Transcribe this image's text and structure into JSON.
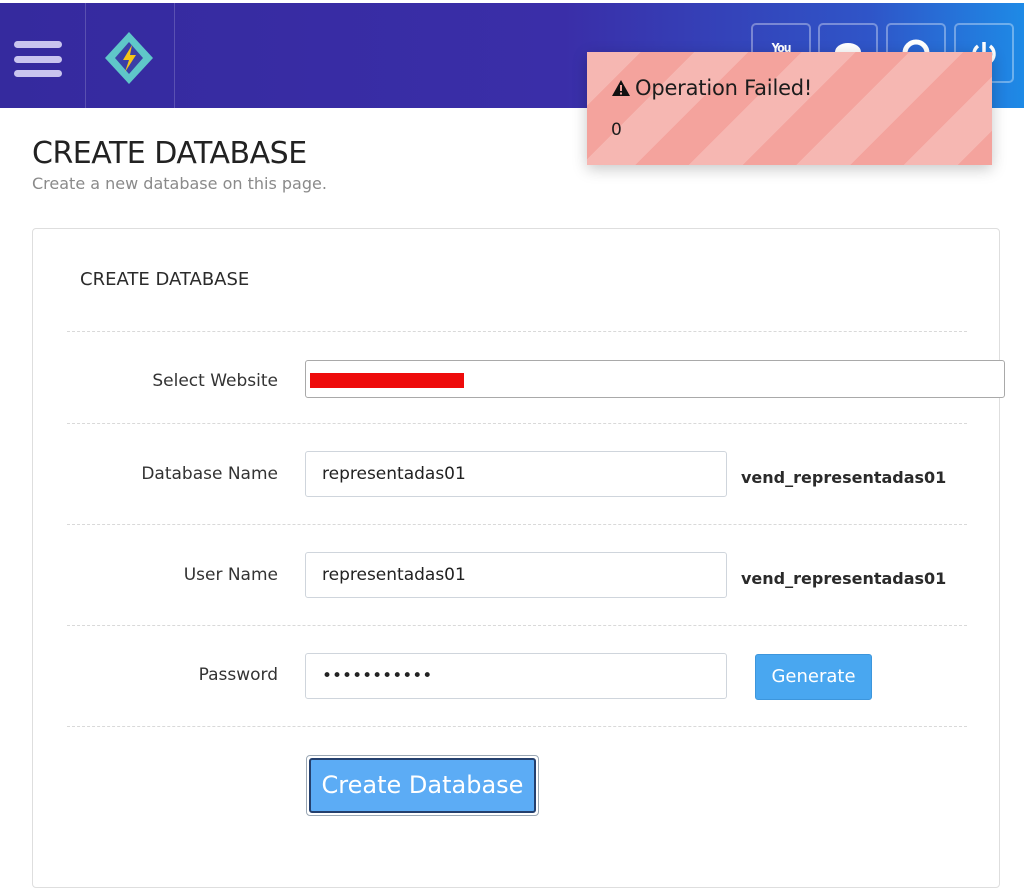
{
  "toast": {
    "title": "Operation Failed!",
    "message": "0",
    "icon": "warning-icon",
    "color": "#f4a39d"
  },
  "topbar": {
    "icons": [
      "menu-icon",
      "logo-icon",
      "youtube-icon",
      "chat-icon",
      "lifebuoy-icon",
      "power-icon"
    ],
    "youtube_text": "You",
    "colors": {
      "start": "#352a9e",
      "end": "#1e8ae6"
    }
  },
  "page": {
    "title": "CREATE DATABASE",
    "subtitle": "Create a new database on this page."
  },
  "panel": {
    "title": "CREATE DATABASE"
  },
  "form": {
    "website": {
      "label": "Select Website"
    },
    "db_name": {
      "label": "Database Name",
      "value": "representadas01",
      "suffix": "vend_representadas01"
    },
    "user_name": {
      "label": "User Name",
      "value": "representadas01",
      "suffix": "vend_representadas01"
    },
    "password": {
      "label": "Password",
      "value": "•••••••••••",
      "generate_label": "Generate"
    },
    "submit_label": "Create Database"
  }
}
